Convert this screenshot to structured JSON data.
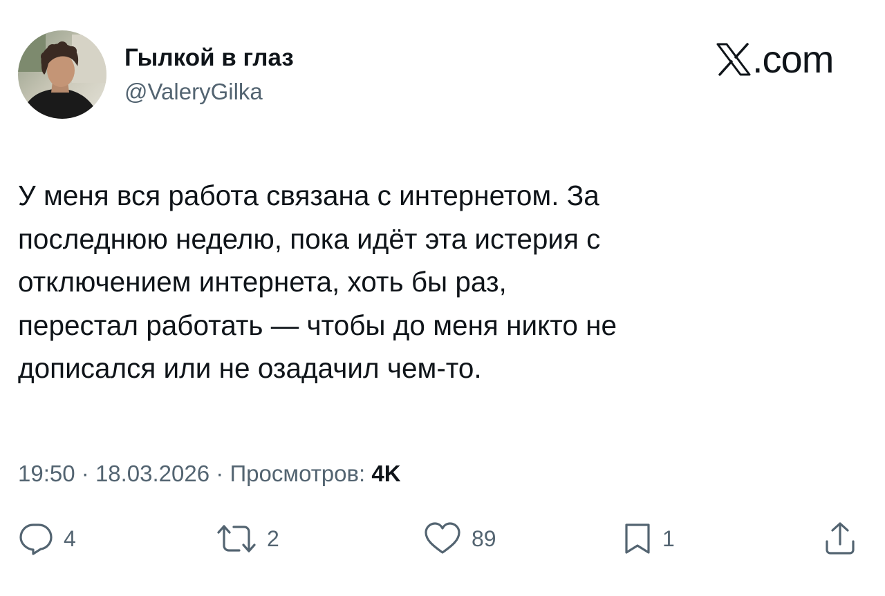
{
  "author": {
    "display_name": "Гылкой в глаз",
    "handle": "@ValeryGilka",
    "avatar_icon": "avatar-photo"
  },
  "brand": {
    "label": ".com",
    "icon": "x-logo-icon"
  },
  "tweet": {
    "lines": [
      "У меня вся работа связана с интернетом. За",
      "последнюю неделю, пока идёт эта истерия с",
      "отключением интернета, хоть бы раз,",
      "перестал работать — чтобы до меня никто не",
      "дописался или не озадачил чем-то."
    ]
  },
  "meta": {
    "time": "19:50",
    "separator": "·",
    "date": "18.03.2026",
    "views_label": "Просмотров:",
    "views_count": "4K"
  },
  "actions": {
    "reply": {
      "icon": "reply-icon",
      "count": "4"
    },
    "repost": {
      "icon": "repost-icon",
      "count": "2"
    },
    "like": {
      "icon": "heart-icon",
      "count": "89"
    },
    "bookmark": {
      "icon": "bookmark-icon",
      "count": "1"
    },
    "share": {
      "icon": "share-icon"
    }
  },
  "colors": {
    "text": "#0f1419",
    "secondary": "#536471",
    "background": "#ffffff"
  }
}
